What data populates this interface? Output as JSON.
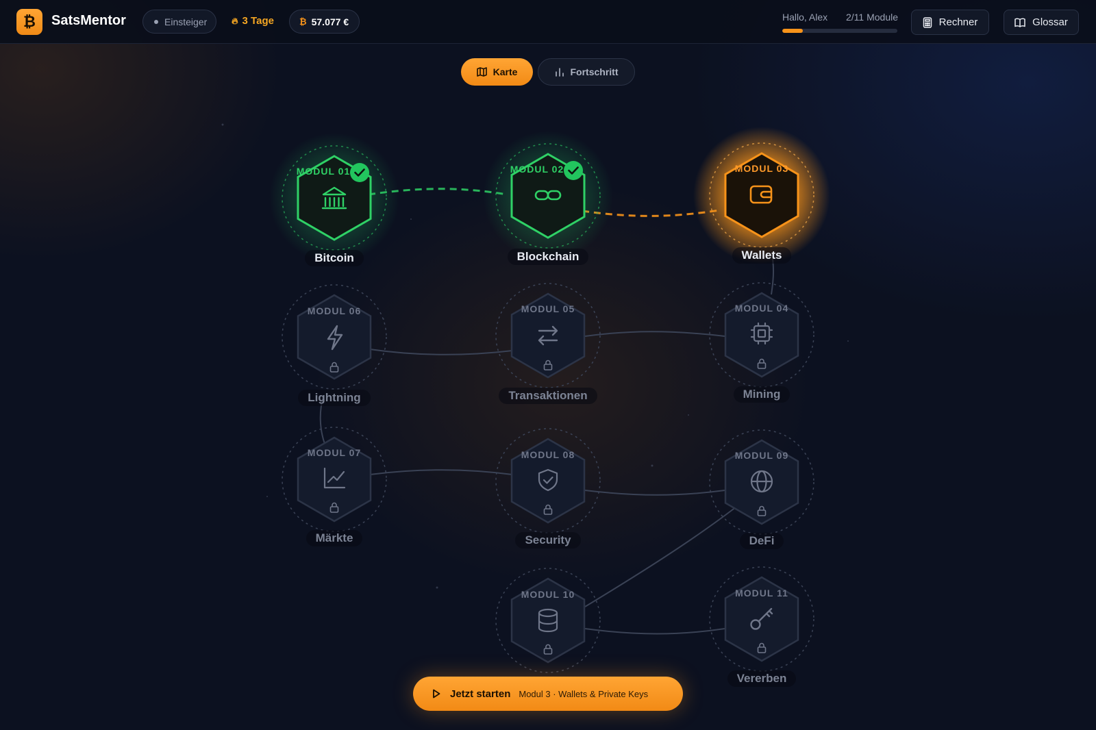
{
  "app": {
    "brand": "SatsMentor",
    "logo_symbol": "₿"
  },
  "header": {
    "level": "Einsteiger",
    "streak": "3 Tage",
    "btc_price": "57.077 €",
    "greeting": "Hallo, Alex",
    "module_count": "2/11 Module",
    "progress_fraction": 0.18,
    "calculator_label": "Rechner",
    "glossary_label": "Glossar"
  },
  "view_tabs": [
    {
      "label": "Karte",
      "icon": "map-icon",
      "active": true
    },
    {
      "label": "Fortschritt",
      "icon": "bar-chart-icon",
      "active": false
    }
  ],
  "modules": [
    {
      "tag": "MODUL 01",
      "title": "Bitcoin",
      "icon": "bank-icon",
      "status": "done"
    },
    {
      "tag": "MODUL 02",
      "title": "Blockchain",
      "icon": "chain-link-icon",
      "status": "done"
    },
    {
      "tag": "MODUL 03",
      "title": "Wallets",
      "icon": "wallet-icon",
      "status": "active"
    },
    {
      "tag": "MODUL 04",
      "title": "Mining",
      "icon": "cpu-icon",
      "status": "locked"
    },
    {
      "tag": "MODUL 05",
      "title": "Transaktionen",
      "icon": "arrows-exchange-icon",
      "status": "locked"
    },
    {
      "tag": "MODUL 06",
      "title": "Lightning",
      "icon": "lightning-icon",
      "status": "locked"
    },
    {
      "tag": "MODUL 07",
      "title": "Märkte",
      "icon": "trend-chart-icon",
      "status": "locked"
    },
    {
      "tag": "MODUL 08",
      "title": "Security",
      "icon": "shield-icon",
      "status": "locked"
    },
    {
      "tag": "MODUL 09",
      "title": "DeFi",
      "icon": "globe-icon",
      "status": "locked"
    },
    {
      "tag": "MODUL 10",
      "title": "",
      "icon": "database-icon",
      "status": "locked"
    },
    {
      "tag": "MODUL 11",
      "title": "Vererben",
      "icon": "key-icon",
      "status": "locked"
    }
  ],
  "cta": {
    "label": "Jetzt starten",
    "subtitle": "Modul 3 · Wallets & Private Keys"
  },
  "colors": {
    "accent": "#f7931a",
    "done": "#2fd166",
    "locked": "#6f7689",
    "background": "#0c1120"
  }
}
